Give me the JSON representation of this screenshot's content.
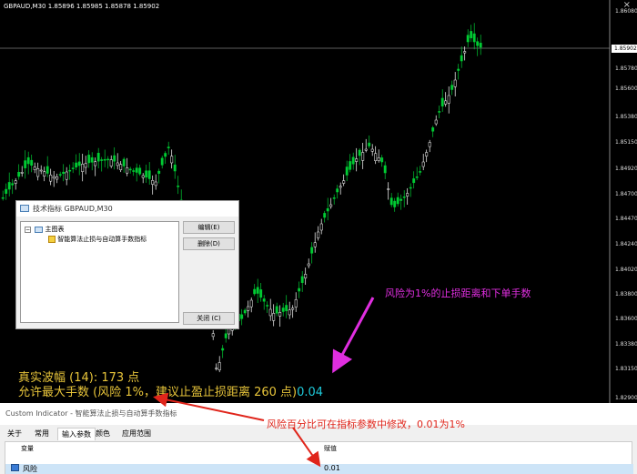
{
  "chart": {
    "title": "GBPAUD,M30  1.85896 1.85985 1.85878 1.85902",
    "close_glyph": "×",
    "current_price": "1.85902",
    "price_labels": [
      "1.86080",
      "1.85902",
      "1.85780",
      "1.85600",
      "1.85380",
      "1.85150",
      "1.84920",
      "1.84700",
      "1.84470",
      "1.84240",
      "1.84020",
      "1.83800",
      "1.83600",
      "1.83380",
      "1.83150",
      "1.82900"
    ],
    "colors": {
      "bull": "#ffffff",
      "bear": "#00cc33",
      "background": "#000000"
    }
  },
  "dialog": {
    "title": "技术指标 GBPAUD,M30",
    "help_glyph": "?",
    "close_glyph": "×",
    "tree_root": "主图表",
    "tree_item": "智能算法止损与自动算手数指标",
    "buttons": {
      "edit": "编辑(E)",
      "delete": "删除(D)",
      "close": "关闭 (C)"
    }
  },
  "overlay": {
    "line1": "真实波幅 (14): 173 点",
    "line2": "允许最大手数 (风险 1%，建议止盈止损距离 260 点)",
    "lot_value": "0.04"
  },
  "annotations": {
    "magenta": "风险为1%的止损距离和下单手数",
    "red": "风险百分比可在指标参数中修改，0.01为1%"
  },
  "properties": {
    "title": "Custom Indicator - 智能算法止损与自动算手数指标",
    "tabs": [
      "关于",
      "常用",
      "输入参数",
      "颜色",
      "应用范围"
    ],
    "active_tab": "输入参数",
    "columns": {
      "variable": "变量",
      "value": "赋值"
    },
    "row": {
      "name": "风险",
      "value": "0.01"
    }
  }
}
